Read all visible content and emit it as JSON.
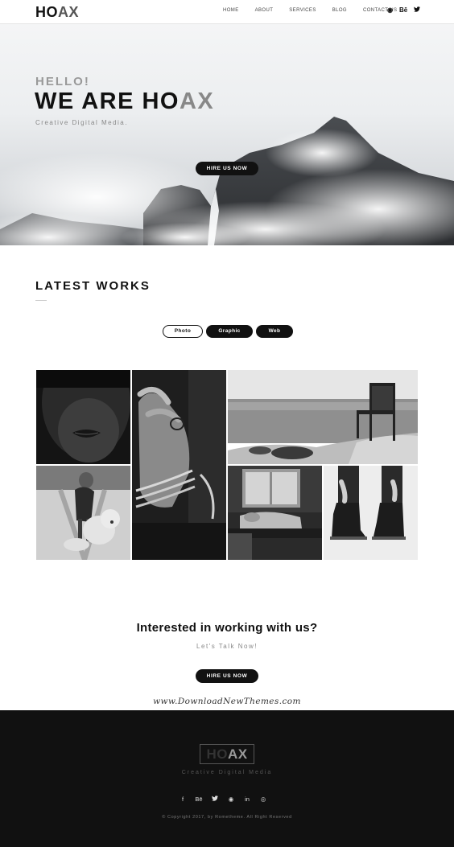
{
  "brand": {
    "logo_dark": "HO",
    "logo_light": "AX"
  },
  "nav": {
    "items": [
      "HOME",
      "ABOUT",
      "SERVICES",
      "BLOG",
      "CONTACT US"
    ]
  },
  "social_top": [
    "◉",
    "Bē",
    "🐦"
  ],
  "hero": {
    "kicker": "HELLO!",
    "headline_dark": "WE ARE HO",
    "headline_light": "AX",
    "subtitle": "Creative Digital Media.",
    "cta": "HIRE US NOW"
  },
  "works": {
    "title": "LATEST WORKS",
    "filters": [
      "Photo",
      "Graphic",
      "Web"
    ],
    "active_filter": "Photo",
    "tiles": [
      "portrait-lips",
      "hand-rope-bracelet",
      "chair-on-shore",
      "girl-with-teddy",
      "person-on-couch",
      "boots-laces"
    ]
  },
  "cta": {
    "title": "Interested in working with us?",
    "subtitle": "Let's Talk Now!",
    "button": "HIRE US NOW"
  },
  "watermark": "www.DownloadNewThemes.com",
  "footer": {
    "logo_dark": "HO",
    "logo_light": "AX",
    "tagline": "Creative Digital Media",
    "social": [
      "f",
      "Bē",
      "🐦",
      "◉",
      "in",
      "◎"
    ],
    "copyright": "© Copyright 2017, by Rometheme. All Right Reserved"
  },
  "colors": {
    "accent": "#111111",
    "muted": "#888888",
    "footer_bg": "#111111"
  }
}
